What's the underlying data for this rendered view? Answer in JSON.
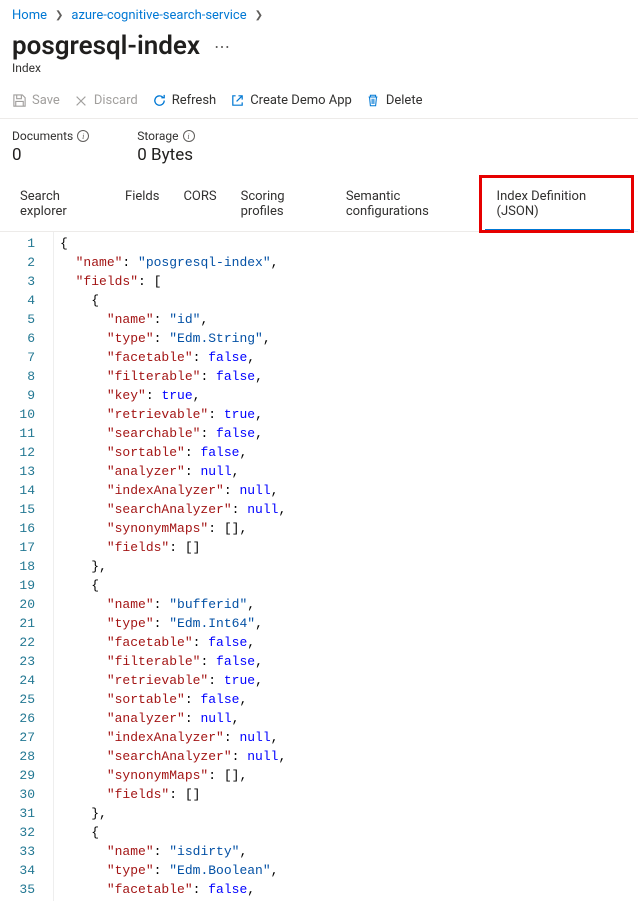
{
  "breadcrumb": {
    "home": "Home",
    "service": "azure-cognitive-search-service"
  },
  "page": {
    "title": "posgresql-index",
    "subtitle": "Index"
  },
  "toolbar": {
    "save": "Save",
    "discard": "Discard",
    "refresh": "Refresh",
    "create_demo": "Create Demo App",
    "delete": "Delete"
  },
  "stats": {
    "documents_label": "Documents",
    "documents_value": "0",
    "storage_label": "Storage",
    "storage_value": "0 Bytes"
  },
  "tabs": {
    "search_explorer": "Search explorer",
    "fields": "Fields",
    "cors": "CORS",
    "scoring": "Scoring profiles",
    "semantic": "Semantic configurations",
    "index_def": "Index Definition (JSON)"
  },
  "code_lines": [
    [
      [
        "delim",
        "{"
      ]
    ],
    [
      [
        "sp",
        "  "
      ],
      [
        "key",
        "\"name\""
      ],
      [
        "delim",
        ": "
      ],
      [
        "str",
        "\"posgresql-index\""
      ],
      [
        "delim",
        ","
      ]
    ],
    [
      [
        "sp",
        "  "
      ],
      [
        "key",
        "\"fields\""
      ],
      [
        "delim",
        ": ["
      ]
    ],
    [
      [
        "sp",
        "    "
      ],
      [
        "delim",
        "{"
      ]
    ],
    [
      [
        "sp",
        "      "
      ],
      [
        "key",
        "\"name\""
      ],
      [
        "delim",
        ": "
      ],
      [
        "str",
        "\"id\""
      ],
      [
        "delim",
        ","
      ]
    ],
    [
      [
        "sp",
        "      "
      ],
      [
        "key",
        "\"type\""
      ],
      [
        "delim",
        ": "
      ],
      [
        "str",
        "\"Edm.String\""
      ],
      [
        "delim",
        ","
      ]
    ],
    [
      [
        "sp",
        "      "
      ],
      [
        "key",
        "\"facetable\""
      ],
      [
        "delim",
        ": "
      ],
      [
        "kw",
        "false"
      ],
      [
        "delim",
        ","
      ]
    ],
    [
      [
        "sp",
        "      "
      ],
      [
        "key",
        "\"filterable\""
      ],
      [
        "delim",
        ": "
      ],
      [
        "kw",
        "false"
      ],
      [
        "delim",
        ","
      ]
    ],
    [
      [
        "sp",
        "      "
      ],
      [
        "key",
        "\"key\""
      ],
      [
        "delim",
        ": "
      ],
      [
        "kw",
        "true"
      ],
      [
        "delim",
        ","
      ]
    ],
    [
      [
        "sp",
        "      "
      ],
      [
        "key",
        "\"retrievable\""
      ],
      [
        "delim",
        ": "
      ],
      [
        "kw",
        "true"
      ],
      [
        "delim",
        ","
      ]
    ],
    [
      [
        "sp",
        "      "
      ],
      [
        "key",
        "\"searchable\""
      ],
      [
        "delim",
        ": "
      ],
      [
        "kw",
        "false"
      ],
      [
        "delim",
        ","
      ]
    ],
    [
      [
        "sp",
        "      "
      ],
      [
        "key",
        "\"sortable\""
      ],
      [
        "delim",
        ": "
      ],
      [
        "kw",
        "false"
      ],
      [
        "delim",
        ","
      ]
    ],
    [
      [
        "sp",
        "      "
      ],
      [
        "key",
        "\"analyzer\""
      ],
      [
        "delim",
        ": "
      ],
      [
        "kw",
        "null"
      ],
      [
        "delim",
        ","
      ]
    ],
    [
      [
        "sp",
        "      "
      ],
      [
        "key",
        "\"indexAnalyzer\""
      ],
      [
        "delim",
        ": "
      ],
      [
        "kw",
        "null"
      ],
      [
        "delim",
        ","
      ]
    ],
    [
      [
        "sp",
        "      "
      ],
      [
        "key",
        "\"searchAnalyzer\""
      ],
      [
        "delim",
        ": "
      ],
      [
        "kw",
        "null"
      ],
      [
        "delim",
        ","
      ]
    ],
    [
      [
        "sp",
        "      "
      ],
      [
        "key",
        "\"synonymMaps\""
      ],
      [
        "delim",
        ": [],"
      ]
    ],
    [
      [
        "sp",
        "      "
      ],
      [
        "key",
        "\"fields\""
      ],
      [
        "delim",
        ": []"
      ]
    ],
    [
      [
        "sp",
        "    "
      ],
      [
        "delim",
        "},"
      ]
    ],
    [
      [
        "sp",
        "    "
      ],
      [
        "delim",
        "{"
      ]
    ],
    [
      [
        "sp",
        "      "
      ],
      [
        "key",
        "\"name\""
      ],
      [
        "delim",
        ": "
      ],
      [
        "str",
        "\"bufferid\""
      ],
      [
        "delim",
        ","
      ]
    ],
    [
      [
        "sp",
        "      "
      ],
      [
        "key",
        "\"type\""
      ],
      [
        "delim",
        ": "
      ],
      [
        "str",
        "\"Edm.Int64\""
      ],
      [
        "delim",
        ","
      ]
    ],
    [
      [
        "sp",
        "      "
      ],
      [
        "key",
        "\"facetable\""
      ],
      [
        "delim",
        ": "
      ],
      [
        "kw",
        "false"
      ],
      [
        "delim",
        ","
      ]
    ],
    [
      [
        "sp",
        "      "
      ],
      [
        "key",
        "\"filterable\""
      ],
      [
        "delim",
        ": "
      ],
      [
        "kw",
        "false"
      ],
      [
        "delim",
        ","
      ]
    ],
    [
      [
        "sp",
        "      "
      ],
      [
        "key",
        "\"retrievable\""
      ],
      [
        "delim",
        ": "
      ],
      [
        "kw",
        "true"
      ],
      [
        "delim",
        ","
      ]
    ],
    [
      [
        "sp",
        "      "
      ],
      [
        "key",
        "\"sortable\""
      ],
      [
        "delim",
        ": "
      ],
      [
        "kw",
        "false"
      ],
      [
        "delim",
        ","
      ]
    ],
    [
      [
        "sp",
        "      "
      ],
      [
        "key",
        "\"analyzer\""
      ],
      [
        "delim",
        ": "
      ],
      [
        "kw",
        "null"
      ],
      [
        "delim",
        ","
      ]
    ],
    [
      [
        "sp",
        "      "
      ],
      [
        "key",
        "\"indexAnalyzer\""
      ],
      [
        "delim",
        ": "
      ],
      [
        "kw",
        "null"
      ],
      [
        "delim",
        ","
      ]
    ],
    [
      [
        "sp",
        "      "
      ],
      [
        "key",
        "\"searchAnalyzer\""
      ],
      [
        "delim",
        ": "
      ],
      [
        "kw",
        "null"
      ],
      [
        "delim",
        ","
      ]
    ],
    [
      [
        "sp",
        "      "
      ],
      [
        "key",
        "\"synonymMaps\""
      ],
      [
        "delim",
        ": [],"
      ]
    ],
    [
      [
        "sp",
        "      "
      ],
      [
        "key",
        "\"fields\""
      ],
      [
        "delim",
        ": []"
      ]
    ],
    [
      [
        "sp",
        "    "
      ],
      [
        "delim",
        "},"
      ]
    ],
    [
      [
        "sp",
        "    "
      ],
      [
        "delim",
        "{"
      ]
    ],
    [
      [
        "sp",
        "      "
      ],
      [
        "key",
        "\"name\""
      ],
      [
        "delim",
        ": "
      ],
      [
        "str",
        "\"isdirty\""
      ],
      [
        "delim",
        ","
      ]
    ],
    [
      [
        "sp",
        "      "
      ],
      [
        "key",
        "\"type\""
      ],
      [
        "delim",
        ": "
      ],
      [
        "str",
        "\"Edm.Boolean\""
      ],
      [
        "delim",
        ","
      ]
    ],
    [
      [
        "sp",
        "      "
      ],
      [
        "key",
        "\"facetable\""
      ],
      [
        "delim",
        ": "
      ],
      [
        "kw",
        "false"
      ],
      [
        "delim",
        ","
      ]
    ]
  ]
}
